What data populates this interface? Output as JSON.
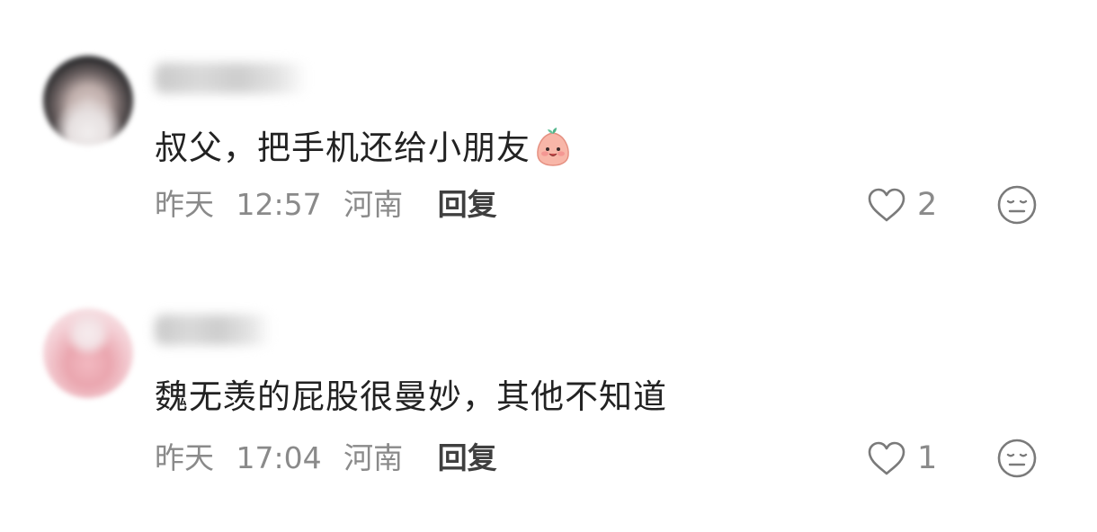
{
  "comments": [
    {
      "text": "叔父，把手机还给小朋友",
      "emoji": "peach-face-emoji",
      "date": "昨天",
      "time": "12:57",
      "location": "河南",
      "reply_label": "回复",
      "likes": "2"
    },
    {
      "text": "魏无羡的屁股很曼妙，其他不知道",
      "date": "昨天",
      "time": "17:04",
      "location": "河南",
      "reply_label": "回复",
      "likes": "1"
    }
  ],
  "icons": {
    "like": "heart-outline-icon",
    "dislike": "neutral-face-icon"
  },
  "colors": {
    "text": "#222222",
    "meta": "#8a8a8a",
    "reply": "#3f3f3f",
    "icon": "#7a7a7a"
  }
}
